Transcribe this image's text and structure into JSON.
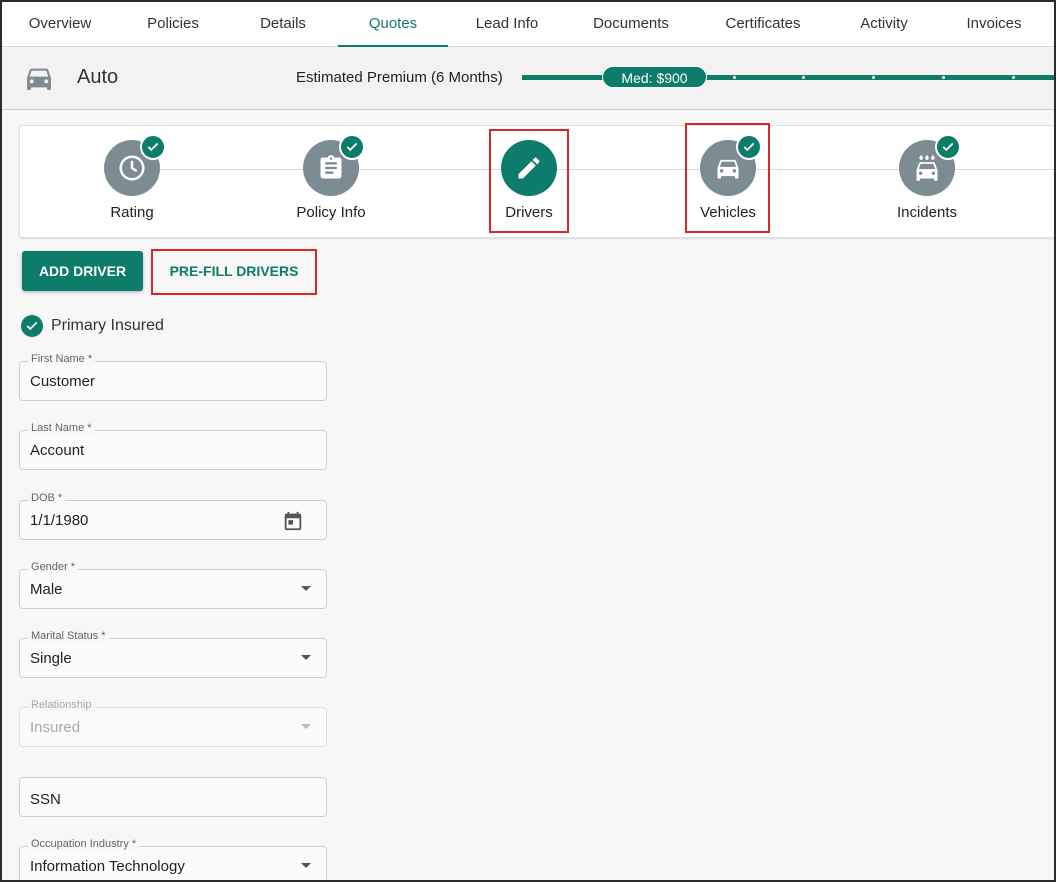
{
  "tabs": [
    "Overview",
    "Policies",
    "Details",
    "Quotes",
    "Lead Info",
    "Documents",
    "Certificates",
    "Activity",
    "Invoices"
  ],
  "active_tab": "Quotes",
  "autobar": {
    "icon": "car-icon",
    "title": "Auto",
    "premium_label": "Estimated Premium (6 Months)",
    "premium_badge": "Med: $900"
  },
  "steps": [
    {
      "label": "Rating",
      "icon": "clock-icon",
      "completed": true
    },
    {
      "label": "Policy Info",
      "icon": "clipboard-icon",
      "completed": true
    },
    {
      "label": "Drivers",
      "icon": "pencil-icon",
      "completed": false,
      "active": true
    },
    {
      "label": "Vehicles",
      "icon": "car-icon",
      "completed": true
    },
    {
      "label": "Incidents",
      "icon": "car-wash-icon",
      "completed": true
    }
  ],
  "buttons": {
    "add_driver": "ADD DRIVER",
    "prefill_drivers": "PRE-FILL DRIVERS"
  },
  "primary_insured": "Primary Insured",
  "fields": {
    "first_name": {
      "label": "First Name *",
      "value": "Customer"
    },
    "last_name": {
      "label": "Last Name *",
      "value": "Account"
    },
    "dob": {
      "label": "DOB *",
      "value": "1/1/1980"
    },
    "gender": {
      "label": "Gender *",
      "value": "Male"
    },
    "marital_status": {
      "label": "Marital Status *",
      "value": "Single"
    },
    "relationship": {
      "label": "Relationship",
      "value": "Insured"
    },
    "ssn": {
      "label": "",
      "value": "SSN"
    },
    "occupation_industry": {
      "label": "Occupation Industry *",
      "value": "Information Technology"
    }
  },
  "colors": {
    "accent": "#0e7c6b",
    "step_inactive": "#7d8c93",
    "highlight": "#d9262a"
  }
}
